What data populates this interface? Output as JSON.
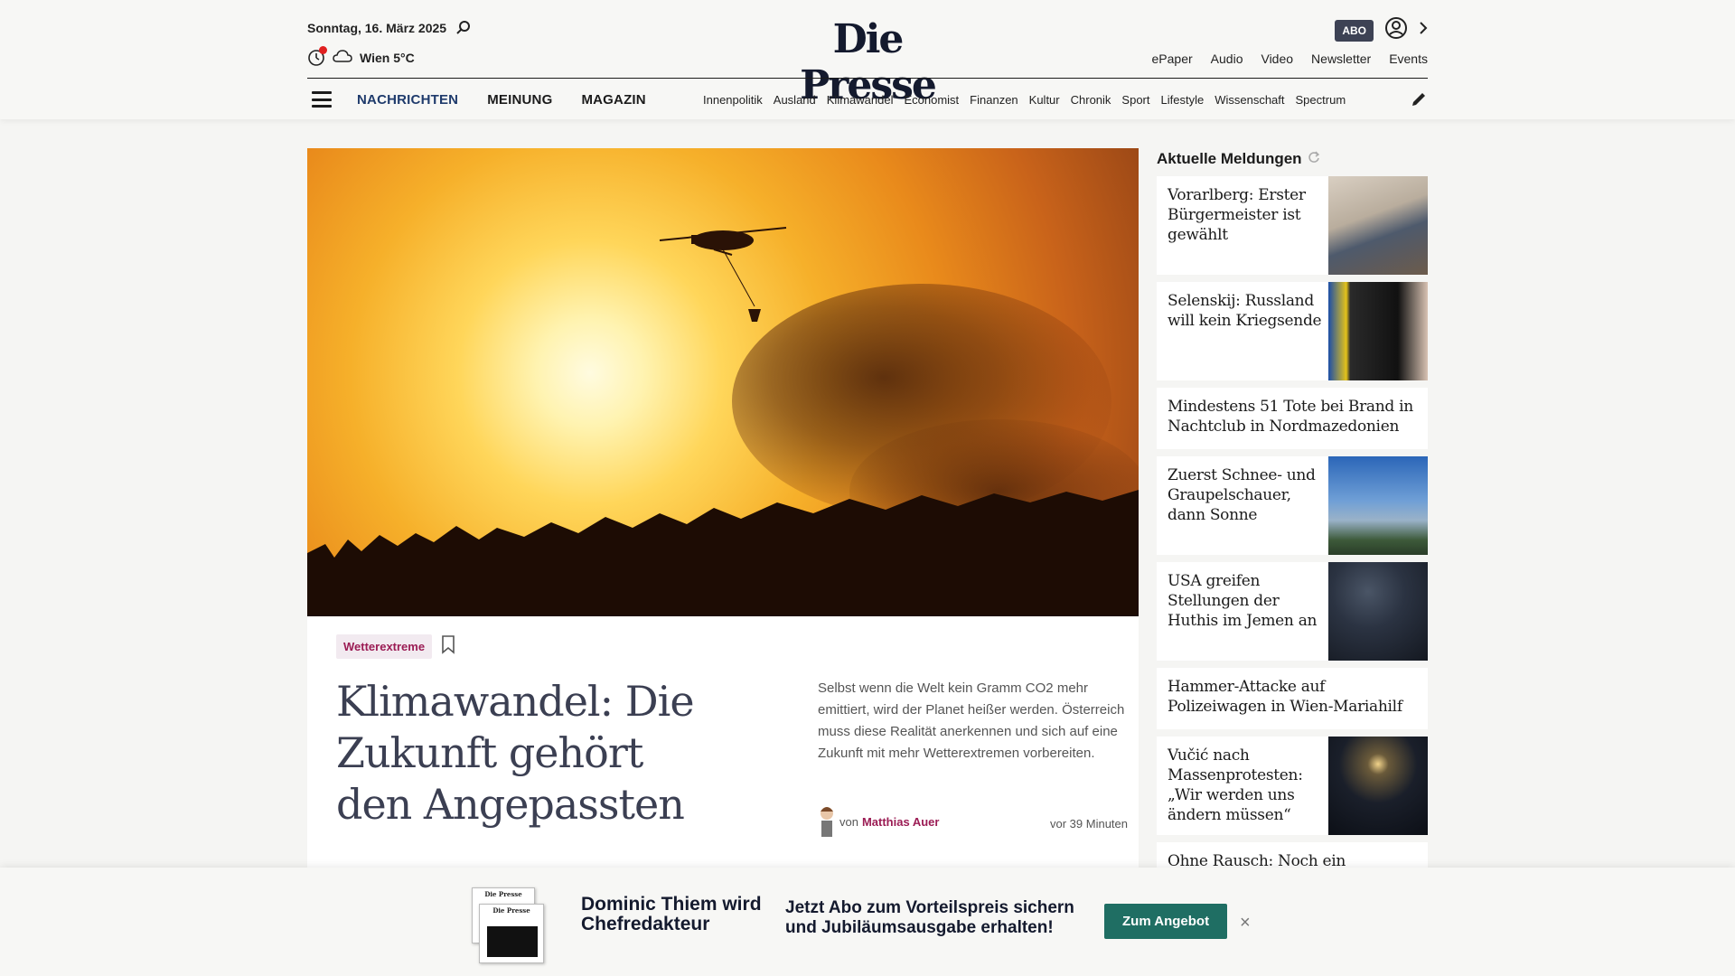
{
  "header": {
    "date": "Sonntag, 16. März 2025",
    "weather": "Wien 5°C",
    "logo": "Die Presse",
    "abo_label": "ABO",
    "util_links": [
      "ePaper",
      "Audio",
      "Video",
      "Newsletter",
      "Events"
    ]
  },
  "nav": {
    "main": [
      "NACHRICHTEN",
      "MEINUNG",
      "MAGAZIN"
    ],
    "sub": [
      "Innenpolitik",
      "Ausland",
      "Klimawandel",
      "Economist",
      "Finanzen",
      "Kultur",
      "Chronik",
      "Sport",
      "Lifestyle",
      "Wissenschaft",
      "Spectrum"
    ]
  },
  "article": {
    "tag": "Wetterextreme",
    "headline": "Klimawandel: Die Zukunft gehört den Angepassten",
    "teaser": "Selbst wenn die Welt kein Gramm CO2 mehr emittiert, wird der Planet heißer werden. Österreich muss diese Realität anerkennen und sich auf eine Zukunft mit mehr Wetterextremen vorbereiten.",
    "by_prefix": "von",
    "author": "Matthias Auer",
    "time": "vor 39 Minuten"
  },
  "sidebar": {
    "title": "Aktuelle Meldungen",
    "items": [
      {
        "title": "Vorarlberg: Erster Bürgermeister ist gewählt"
      },
      {
        "title": "Selenskij: Russland will kein Kriegsende"
      },
      {
        "title": "Mindestens 51 Tote bei Brand in Nachtclub in Nordmazedonien"
      },
      {
        "title": "Zuerst Schnee- und Graupelschauer, dann Sonne"
      },
      {
        "title": "USA greifen Stellungen der Huthis im Jemen an"
      },
      {
        "title": "Hammer-Attacke auf Polizeiwagen in Wien-Mariahilf"
      },
      {
        "title": "Vučić nach Massenprotesten: „Wir werden uns ändern müssen“"
      },
      {
        "title": "Ohne Rausch: Noch ein"
      }
    ]
  },
  "promo": {
    "paper_label": "Die Presse",
    "name": "Dominic Thiem wird Chefredakteur",
    "offer": "Jetzt Abo zum Vorteilspreis sichern und Jubiläumsausgabe erhalten!",
    "button": "Zum Angebot",
    "close": "×"
  }
}
